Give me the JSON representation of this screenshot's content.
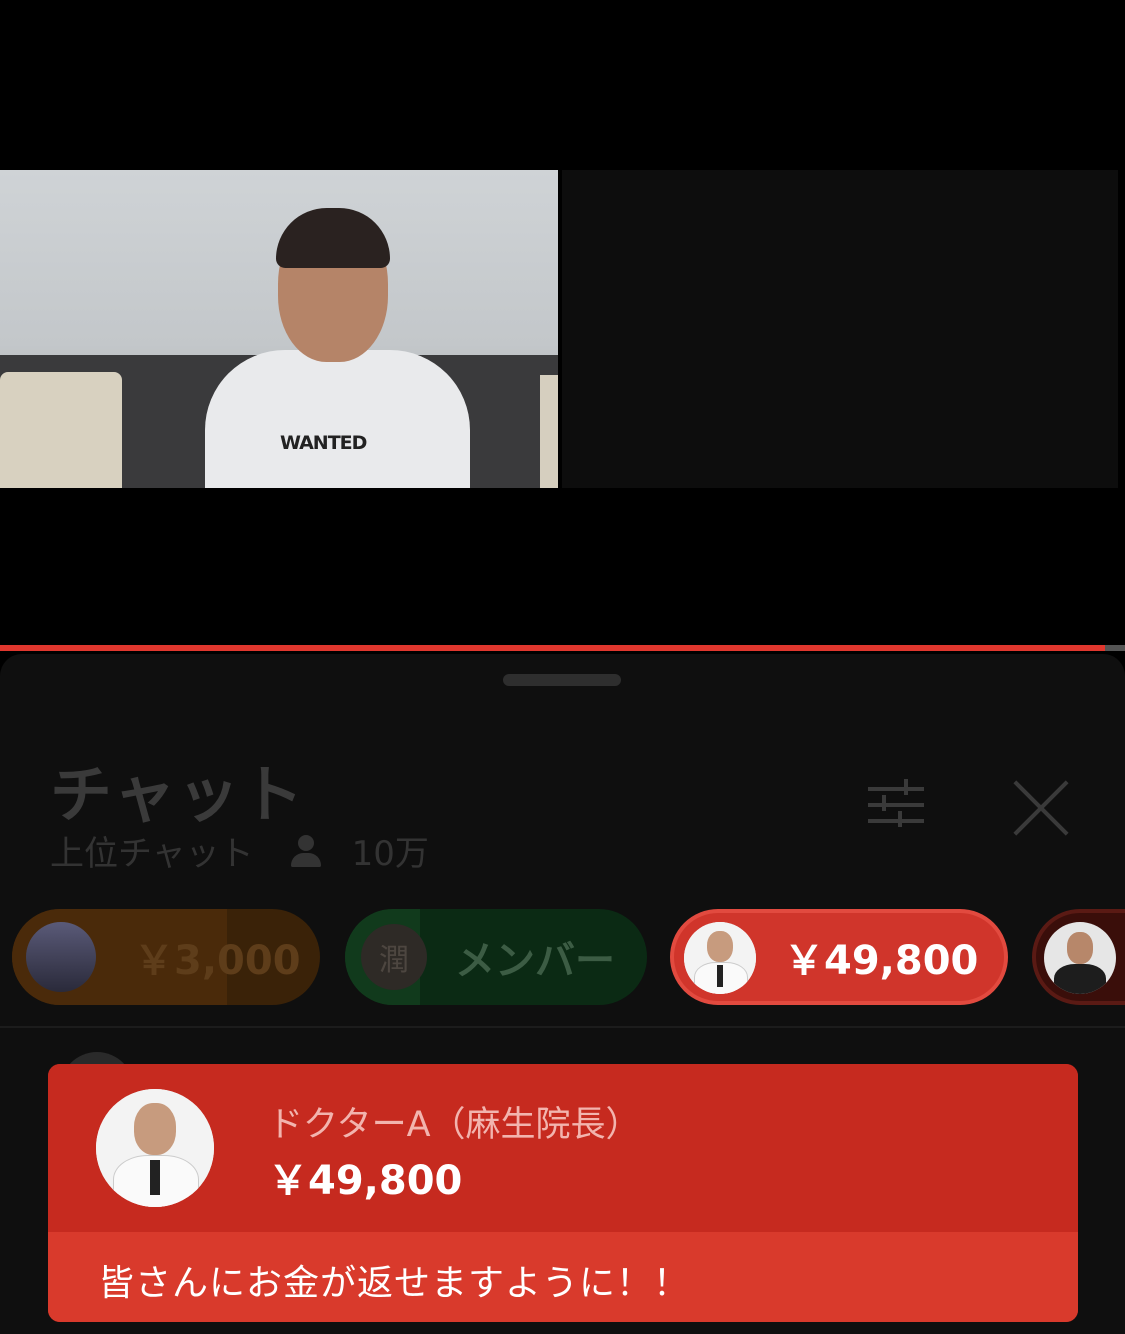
{
  "video": {
    "shirt_text": "WANTED",
    "progress": 0.982
  },
  "chat": {
    "title": "チャット",
    "mode": "上位チャット",
    "viewer_count": "10万",
    "icons": [
      "person-icon",
      "filter-sliders-icon",
      "close-icon"
    ]
  },
  "ticker": [
    {
      "avatar_text": "",
      "label": "￥3,000",
      "color": "#e65100"
    },
    {
      "avatar_text": "潤",
      "label": "メンバー",
      "color": "#0f9d58"
    },
    {
      "avatar_text": "",
      "label": "￥49,800",
      "color": "#d0352b"
    },
    {
      "avatar_text": "",
      "label": "",
      "color": "#d0352b"
    }
  ],
  "superchat": {
    "author": "ドクターA（麻生院長）",
    "amount": "￥49,800",
    "message": "皆さんにお金が返せますように！！",
    "color": "#c62a1f"
  }
}
